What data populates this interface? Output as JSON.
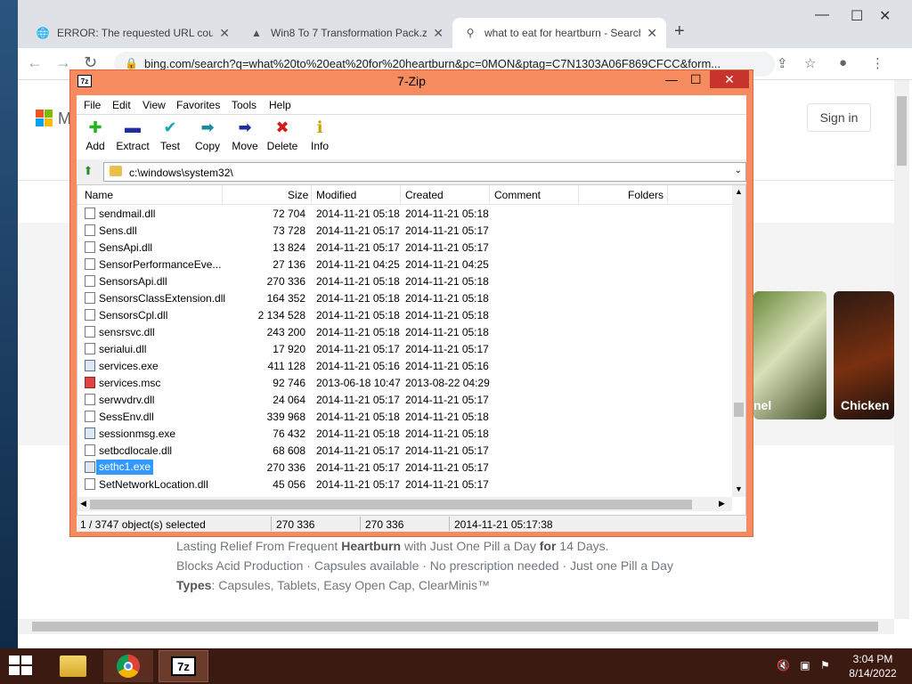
{
  "browser": {
    "tabs": [
      {
        "title": "ERROR: The requested URL could",
        "icon": "globe-icon"
      },
      {
        "title": "Win8 To 7 Transformation Pack.z",
        "icon": "page-icon"
      },
      {
        "title": "what to eat for heartburn - Search",
        "icon": "search-icon"
      }
    ],
    "url": "bing.com/search?q=what%20to%20eat%20for%20heartburn&pc=0MON&ptag=C7N1303A06F869CFCC&form..."
  },
  "bing": {
    "logo_letter": "M",
    "sign_in": "Sign in",
    "image_cards": [
      {
        "caption": "nel"
      },
      {
        "caption": "Chicken"
      }
    ],
    "ad_line1_parts": [
      "Lasting Relief From Frequent ",
      "Heartburn",
      " with Just One Pill a Day ",
      "for",
      " 14 Days."
    ],
    "ad_line2": "Blocks Acid Production · Capsules available · No prescription needed · Just one Pill a Day",
    "ad_line3_label": "Types",
    "ad_line3_text": ": Capsules, Tablets, Easy Open Cap, ClearMinis™"
  },
  "zip": {
    "title": "7-Zip",
    "app_icon_text": "7z",
    "menu": [
      "File",
      "Edit",
      "View",
      "Favorites",
      "Tools",
      "Help"
    ],
    "toolbar": [
      {
        "label": "Add",
        "icon": "add-icon"
      },
      {
        "label": "Extract",
        "icon": "extract-icon"
      },
      {
        "label": "Test",
        "icon": "test-icon"
      },
      {
        "label": "Copy",
        "icon": "copy-icon"
      },
      {
        "label": "Move",
        "icon": "move-icon"
      },
      {
        "label": "Delete",
        "icon": "delete-icon"
      },
      {
        "label": "Info",
        "icon": "info-icon"
      }
    ],
    "path": "c:\\windows\\system32\\",
    "columns": [
      "Name",
      "Size",
      "Modified",
      "Created",
      "Comment",
      "Folders"
    ],
    "files": [
      {
        "name": "sendmail.dll",
        "size": "72 704",
        "modified": "2014-11-21 05:18",
        "created": "2014-11-21 05:18",
        "type": "dll"
      },
      {
        "name": "Sens.dll",
        "size": "73 728",
        "modified": "2014-11-21 05:17",
        "created": "2014-11-21 05:17",
        "type": "dll"
      },
      {
        "name": "SensApi.dll",
        "size": "13 824",
        "modified": "2014-11-21 05:17",
        "created": "2014-11-21 05:17",
        "type": "dll"
      },
      {
        "name": "SensorPerformanceEve...",
        "size": "27 136",
        "modified": "2014-11-21 04:25",
        "created": "2014-11-21 04:25",
        "type": "dll"
      },
      {
        "name": "SensorsApi.dll",
        "size": "270 336",
        "modified": "2014-11-21 05:18",
        "created": "2014-11-21 05:18",
        "type": "dll"
      },
      {
        "name": "SensorsClassExtension.dll",
        "size": "164 352",
        "modified": "2014-11-21 05:18",
        "created": "2014-11-21 05:18",
        "type": "dll"
      },
      {
        "name": "SensorsCpl.dll",
        "size": "2 134 528",
        "modified": "2014-11-21 05:18",
        "created": "2014-11-21 05:18",
        "type": "dll"
      },
      {
        "name": "sensrsvc.dll",
        "size": "243 200",
        "modified": "2014-11-21 05:18",
        "created": "2014-11-21 05:18",
        "type": "dll"
      },
      {
        "name": "serialui.dll",
        "size": "17 920",
        "modified": "2014-11-21 05:17",
        "created": "2014-11-21 05:17",
        "type": "dll"
      },
      {
        "name": "services.exe",
        "size": "411 128",
        "modified": "2014-11-21 05:16",
        "created": "2014-11-21 05:16",
        "type": "exe"
      },
      {
        "name": "services.msc",
        "size": "92 746",
        "modified": "2013-06-18 10:47",
        "created": "2013-08-22 04:29",
        "type": "msc"
      },
      {
        "name": "serwvdrv.dll",
        "size": "24 064",
        "modified": "2014-11-21 05:17",
        "created": "2014-11-21 05:17",
        "type": "dll"
      },
      {
        "name": "SessEnv.dll",
        "size": "339 968",
        "modified": "2014-11-21 05:18",
        "created": "2014-11-21 05:18",
        "type": "dll"
      },
      {
        "name": "sessionmsg.exe",
        "size": "76 432",
        "modified": "2014-11-21 05:18",
        "created": "2014-11-21 05:18",
        "type": "exe"
      },
      {
        "name": "setbcdlocale.dll",
        "size": "68 608",
        "modified": "2014-11-21 05:17",
        "created": "2014-11-21 05:17",
        "type": "dll"
      },
      {
        "name": "sethc1.exe",
        "size": "270 336",
        "modified": "2014-11-21 05:17",
        "created": "2014-11-21 05:17",
        "type": "exe",
        "selected": true
      },
      {
        "name": "SetNetworkLocation.dll",
        "size": "45 056",
        "modified": "2014-11-21 05:17",
        "created": "2014-11-21 05:17",
        "type": "dll"
      }
    ],
    "status": {
      "selection": "1 / 3747 object(s) selected",
      "size": "270 336",
      "packed": "270 336",
      "date": "2014-11-21 05:17:38"
    }
  },
  "taskbar": {
    "zip_icon_text": "7z",
    "time": "3:04 PM",
    "date": "8/14/2022"
  }
}
